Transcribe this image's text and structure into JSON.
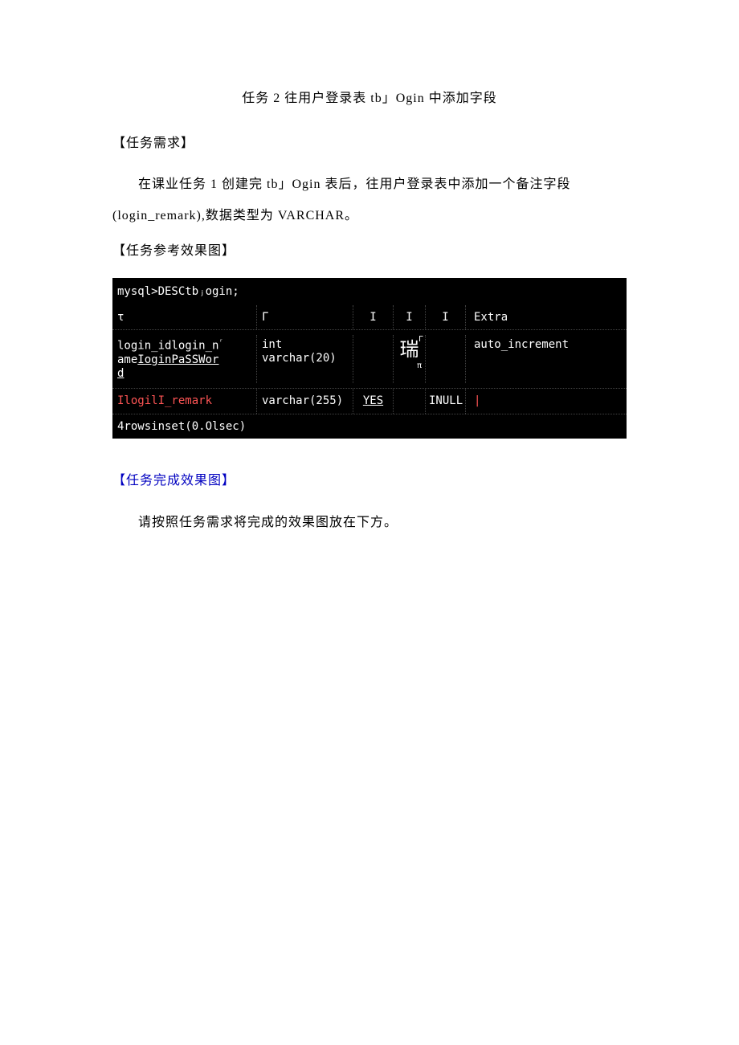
{
  "title": "任务 2 往用户登录表 tb」Ogin 中添加字段",
  "sections": {
    "req_label": "【任务需求】",
    "req_body": "在课业任务 1 创建完 tb」Ogin 表后，往用户登录表中添加一个备注字段 (login_remark),数据类型为 VARCHAR。",
    "ref_label": "【任务参考效果图】",
    "done_label": "【任务完成效果图】",
    "done_body": "请按照任务需求将完成的效果图放在下方。"
  },
  "terminal": {
    "prompt": "mysql>DESCtbⱼogin;",
    "header": {
      "c1": "τ",
      "c2": "Γ",
      "c3": "I",
      "c4": "I",
      "c5": "I",
      "c6": "Extra"
    },
    "row1": {
      "c1a": "login_idlogin_n",
      "c1b_pre": "ame",
      "c1b_ul": "IoginPaSSWor",
      "c1c": "d",
      "c2a": "int",
      "c2b": "varchar(20)",
      "c3_sup": "Γ",
      "c4_big": "瑞",
      "c5_sub": "π",
      "c6": "auto_increment"
    },
    "row2": {
      "c1": "IlogilI_remark",
      "c2": "varchar(255)",
      "c3": "YES",
      "c5": "INULL",
      "c6": "|"
    },
    "footer": "4rowsinset(0.Olsec)"
  }
}
